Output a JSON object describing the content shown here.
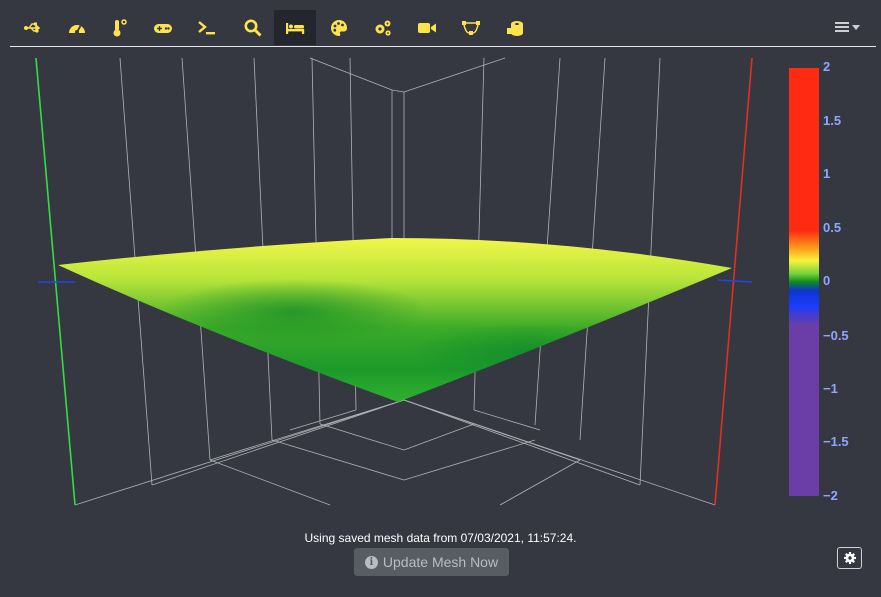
{
  "toolbar": {
    "tabs": [
      {
        "name": "usb-icon"
      },
      {
        "name": "dashboard-icon"
      },
      {
        "name": "thermometer-icon"
      },
      {
        "name": "gamepad-icon"
      },
      {
        "name": "terminal-icon"
      },
      {
        "name": "search-icon"
      },
      {
        "name": "bed-icon",
        "active": true
      },
      {
        "name": "palette-icon"
      },
      {
        "name": "cogs-icon"
      },
      {
        "name": "video-icon"
      },
      {
        "name": "bezier-icon"
      },
      {
        "name": "filament-icon"
      }
    ],
    "menu_icon": "list-menu-icon"
  },
  "colors": {
    "accent": "#ffe34d",
    "background": "#353840",
    "scale_text": "#8fa6ff",
    "surface_green": "#2aa52a",
    "x_axis": "#e03020",
    "y_axis": "#33dd44"
  },
  "color_scale": {
    "labels": [
      "2",
      "1.5",
      "1",
      "0.5",
      "0",
      "−0.5",
      "−1",
      "−1.5",
      "−2"
    ],
    "max": 2,
    "min": -2
  },
  "mesh": {
    "status": "Using saved mesh data from 07/03/2021, 11:57:24.",
    "update_button": "Update Mesh Now"
  }
}
